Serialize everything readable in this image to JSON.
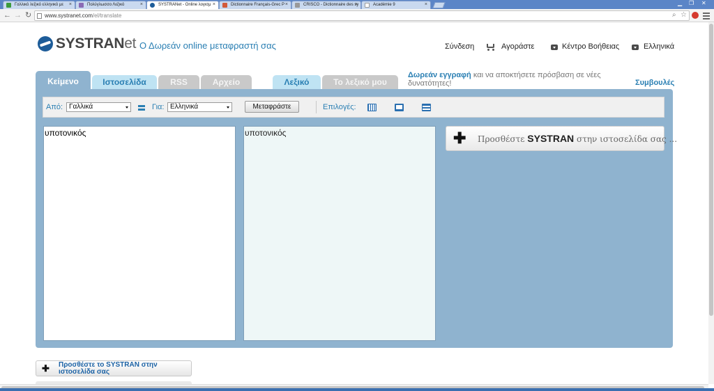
{
  "browser": {
    "tabs": [
      {
        "title": "Γαλλικό λεξικό ελληνικό με"
      },
      {
        "title": "Πολύγλωσσο Λεξικό"
      },
      {
        "title": "SYSTRANet - Online λογισμ"
      },
      {
        "title": "Dictionnaire Français-Grec P"
      },
      {
        "title": "CRISCO - Dictionnaire des sy"
      },
      {
        "title": "Académie 9"
      }
    ],
    "url_host": "www.systranet.com",
    "url_path": "/el/translate"
  },
  "header": {
    "logo_main": "SYSTRAN",
    "logo_suffix": "et",
    "tagline": "Ο Δωρεάν online μεταφραστή σας",
    "nav": {
      "login": "Σύνδεση",
      "buy": "Αγοράστε",
      "help": "Κέντρο Βοήθειας",
      "language": "Ελληνικά"
    }
  },
  "tabs": {
    "text": "Κείμενο",
    "website": "Ιστοσελίδα",
    "rss": "RSS",
    "file": "Αρχείο",
    "dictionary": "Λεξικό",
    "my_dictionary": "Το λεξικό μου"
  },
  "promo": {
    "link": "Δωρεάν εγγραφή",
    "text": "και να αποκτήσετε πρόσβαση σε νέες δυνατότητες!"
  },
  "tips": "Συμβουλές",
  "controls": {
    "from_label": "Από:",
    "from_value": "Γαλλικά",
    "to_label": "Για:",
    "to_value": "Ελληνικά",
    "translate_button": "Μεταφράστε",
    "options_label": "Επιλογές:"
  },
  "source_text": "υποτονικός",
  "output_text": "υποτονικός",
  "add_box": {
    "prefix": "Προσθέστε",
    "brand": "SYSTRAN",
    "suffix": "στην ιστοσελίδα σας ..."
  },
  "bottom_add": "Προσθέστε το SYSTRAN στην ιστοσελίδα σας"
}
